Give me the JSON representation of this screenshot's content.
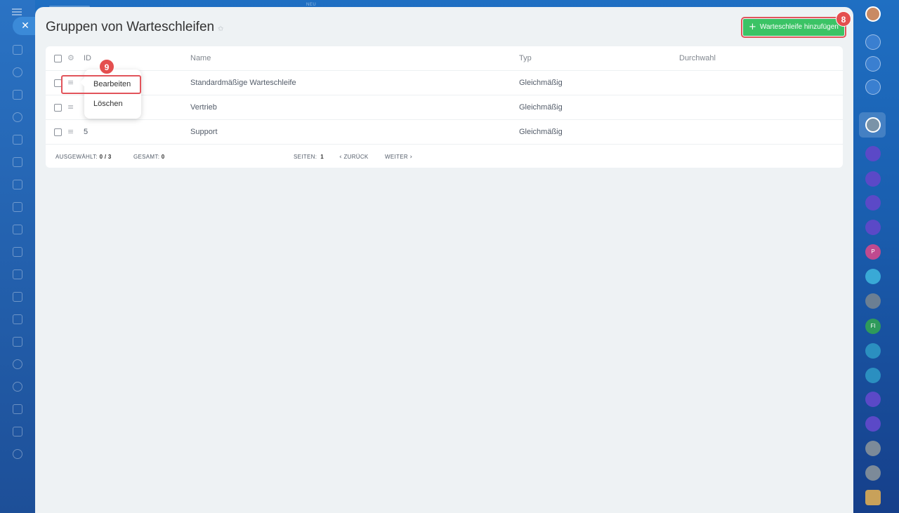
{
  "top": {
    "neu_label": "NEU"
  },
  "header": {
    "title": "Gruppen von Warteschleifen",
    "add_button_label": "Warteschleife hinzufügen",
    "step_marker_add": "8"
  },
  "table": {
    "columns": [
      "ID",
      "Name",
      "Typ",
      "Durchwahl"
    ],
    "rows": [
      {
        "id": "",
        "name": "Standardmäßige Warteschleife",
        "typ": "Gleichmäßig",
        "durchwahl": ""
      },
      {
        "id": "",
        "name": "Vertrieb",
        "typ": "Gleichmäßig",
        "durchwahl": ""
      },
      {
        "id": "5",
        "name": "Support",
        "typ": "Gleichmäßig",
        "durchwahl": ""
      }
    ]
  },
  "footer": {
    "selected_label": "AUSGEWÄHLT:",
    "selected_value": "0 / 3",
    "total_label": "GESAMT:",
    "total_value": "0",
    "pages_label": "SEITEN:",
    "pages_value": "1",
    "prev_label": "ZURÜCK",
    "next_label": "WEITER"
  },
  "context_menu": {
    "edit_label": "Bearbeiten",
    "delete_label": "Löschen",
    "step_marker_edit": "9"
  },
  "right_bar": {
    "avatar_p": "P",
    "avatar_fi": "FI"
  },
  "colors": {
    "accent_green": "#3bc365",
    "highlight_red": "#e2545b",
    "brand_blue": "#1f6fc2"
  }
}
